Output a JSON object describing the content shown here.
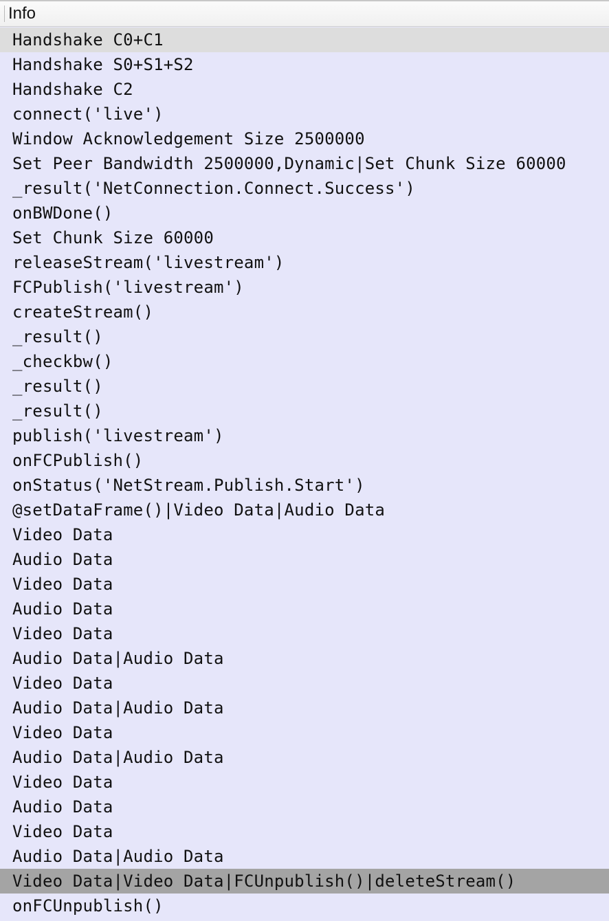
{
  "column": {
    "title": "Info"
  },
  "rows": [
    {
      "text": "Handshake C0+C1",
      "highlight": "light"
    },
    {
      "text": "Handshake S0+S1+S2"
    },
    {
      "text": "Handshake C2"
    },
    {
      "text": "connect('live')"
    },
    {
      "text": "Window Acknowledgement Size 2500000"
    },
    {
      "text": "Set Peer Bandwidth 2500000,Dynamic|Set Chunk Size 60000"
    },
    {
      "text": "_result('NetConnection.Connect.Success')"
    },
    {
      "text": "onBWDone()"
    },
    {
      "text": "Set Chunk Size 60000"
    },
    {
      "text": "releaseStream('livestream')"
    },
    {
      "text": "FCPublish('livestream')"
    },
    {
      "text": "createStream()"
    },
    {
      "text": "_result()"
    },
    {
      "text": "_checkbw()"
    },
    {
      "text": "_result()"
    },
    {
      "text": "_result()"
    },
    {
      "text": "publish('livestream')"
    },
    {
      "text": "onFCPublish()"
    },
    {
      "text": "onStatus('NetStream.Publish.Start')"
    },
    {
      "text": "@setDataFrame()|Video Data|Audio Data"
    },
    {
      "text": "Video Data"
    },
    {
      "text": "Audio Data"
    },
    {
      "text": "Video Data"
    },
    {
      "text": "Audio Data"
    },
    {
      "text": "Video Data"
    },
    {
      "text": "Audio Data|Audio Data"
    },
    {
      "text": "Video Data"
    },
    {
      "text": "Audio Data|Audio Data"
    },
    {
      "text": "Video Data"
    },
    {
      "text": "Audio Data|Audio Data"
    },
    {
      "text": "Video Data"
    },
    {
      "text": "Audio Data"
    },
    {
      "text": "Video Data"
    },
    {
      "text": "Audio Data|Audio Data"
    },
    {
      "text": "Video Data|Video Data|FCUnpublish()|deleteStream()",
      "highlight": "dark"
    },
    {
      "text": "onFCUnpublish()"
    }
  ],
  "colors": {
    "row_background": "#e6e6fa",
    "highlight_light": "#dddddd",
    "highlight_dark": "#a4a4a4",
    "header_background": "#f4f4f4"
  }
}
